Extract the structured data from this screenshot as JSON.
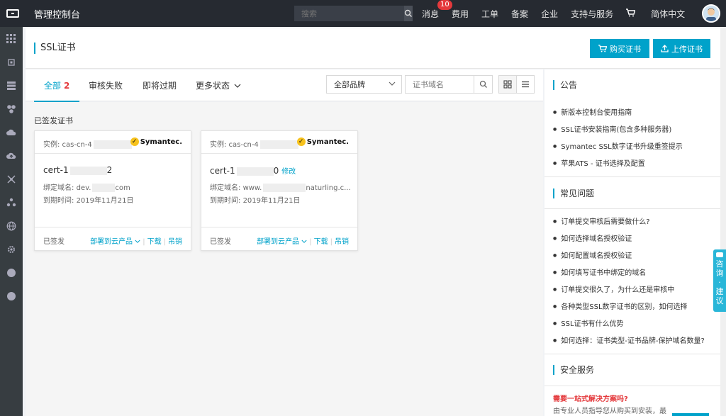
{
  "topbar": {
    "title": "管理控制台",
    "search_placeholder": "搜索",
    "nav": [
      "消息",
      "费用",
      "工单",
      "备案",
      "企业",
      "支持与服务"
    ],
    "message_badge": "10",
    "language": "简体中文"
  },
  "header": {
    "page_title": "SSL证书",
    "buy_label": "购买证书",
    "upload_label": "上传证书"
  },
  "tabs": {
    "all_label": "全部",
    "all_count": "2",
    "failed_label": "审核失败",
    "expiring_label": "即将过期",
    "more_label": "更多状态"
  },
  "filters": {
    "brand_label": "全部品牌",
    "domain_placeholder": "证书域名"
  },
  "section_label": "已签发证书",
  "cards": [
    {
      "instance_prefix": "实例: cas-cn-4",
      "instance_suffix": "",
      "brand": "Symantec.",
      "name_prefix": "cert-1",
      "name_suffix": "2",
      "edit": "",
      "domain_label": "绑定域名:",
      "domain_prefix": "dev.",
      "domain_suffix": "com",
      "expiry_label": "到期时间:",
      "expiry": "2019年11月21日",
      "status": "已签发",
      "deploy": "部署到云产品",
      "download": "下载",
      "revoke": "吊销"
    },
    {
      "instance_prefix": "实例: cas-cn-4",
      "instance_suffix": "",
      "brand": "Symantec.",
      "name_prefix": "cert-1",
      "name_suffix": "0",
      "edit": "修改",
      "domain_label": "绑定域名:",
      "domain_prefix": "www.",
      "domain_suffix": "naturling.c...",
      "expiry_label": "到期时间:",
      "expiry": "2019年11月21日",
      "status": "已签发",
      "deploy": "部署到云产品",
      "download": "下载",
      "revoke": "吊销"
    }
  ],
  "right_panel": {
    "announce_title": "公告",
    "announcements": [
      "新版本控制台使用指南",
      "SSL证书安装指南(包含多种服务器)",
      "Symantec SSL数字证书升级重签提示",
      "苹果ATS - 证书选择及配置"
    ],
    "faq_title": "常见问题",
    "faqs": [
      "订单提交审核后需要做什么?",
      "如何选择域名授权验证",
      "如何配置域名授权验证",
      "如何填写证书中绑定的域名",
      "订单提交很久了，为什么还是审核中",
      "各种类型SSL数字证书的区别，如何选择",
      "SSL证书有什么优势",
      "如何选择：证书类型-证书品牌-保护域名数量?"
    ],
    "security_title": "安全服务",
    "promo_title": "需要一站式解决方案吗?",
    "promo_text": "由专业人员指导您从购买到安装，最"
  },
  "consult": [
    "咨",
    "询",
    "·",
    "建",
    "议"
  ]
}
